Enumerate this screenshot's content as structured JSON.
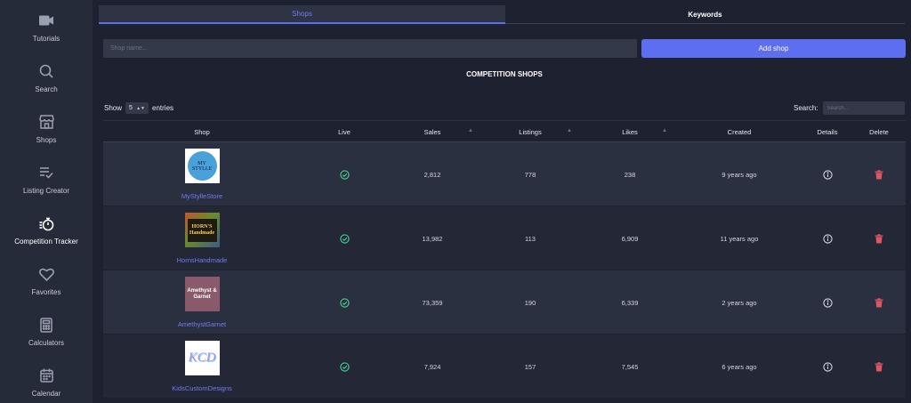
{
  "sidebar": {
    "items": [
      {
        "label": "Tutorials",
        "icon": "video-camera-icon"
      },
      {
        "label": "Search",
        "icon": "search-icon"
      },
      {
        "label": "Shops",
        "icon": "store-icon"
      },
      {
        "label": "Listing Creator",
        "icon": "list-check-icon"
      },
      {
        "label": "Competition Tracker",
        "icon": "stopwatch-icon",
        "active": true
      },
      {
        "label": "Favorites",
        "icon": "heart-icon"
      },
      {
        "label": "Calculators",
        "icon": "calculator-icon"
      },
      {
        "label": "Calendar",
        "icon": "calendar-icon"
      }
    ]
  },
  "tabs": {
    "shops": "Shops",
    "keywords": "Keywords"
  },
  "form": {
    "placeholder": "Shop name...",
    "add_label": "Add shop"
  },
  "section_title": "COMPETITION SHOPS",
  "table_controls": {
    "show": "Show",
    "entries_value": "5",
    "entries": "entries",
    "search_label": "Search:",
    "search_placeholder": "Search..."
  },
  "columns": {
    "shop": "Shop",
    "live": "Live",
    "sales": "Sales",
    "listings": "Listings",
    "likes": "Likes",
    "created": "Created",
    "details": "Details",
    "delete": "Delete"
  },
  "rows": [
    {
      "shop": "MyStylleStore",
      "logo_text": "MY STYLLE",
      "sales": "2,812",
      "listings": "778",
      "likes": "238",
      "created": "9 years ago"
    },
    {
      "shop": "HornsHandmade",
      "logo_text": "HORN'S Handmade",
      "sales": "13,982",
      "listings": "113",
      "likes": "6,909",
      "created": "11 years ago"
    },
    {
      "shop": "AmethystGarnet",
      "logo_text": "Amethyst & Garnet",
      "sales": "73,359",
      "listings": "190",
      "likes": "6,339",
      "created": "2 years ago"
    },
    {
      "shop": "KidsCustomDesigns",
      "logo_text": "KCD",
      "sales": "7,924",
      "listings": "157",
      "likes": "7,545",
      "created": "6 years ago"
    }
  ],
  "colors": {
    "accent": "#5d6ef0",
    "live": "#3ecf8e",
    "delete": "#e05563",
    "link": "#6f7cf2"
  }
}
